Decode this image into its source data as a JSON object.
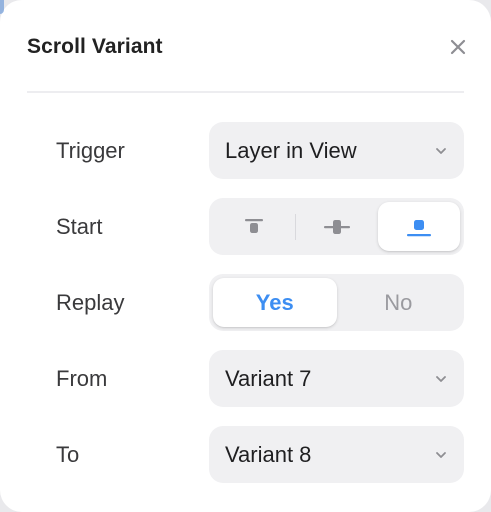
{
  "panel": {
    "title": "Scroll Variant"
  },
  "fields": {
    "trigger": {
      "label": "Trigger",
      "value": "Layer in View"
    },
    "start": {
      "label": "Start",
      "options": [
        "align-top-icon",
        "align-center-icon",
        "align-bottom-icon"
      ],
      "selected": "align-bottom-icon"
    },
    "replay": {
      "label": "Replay",
      "options": [
        "Yes",
        "No"
      ],
      "selected": "Yes"
    },
    "from": {
      "label": "From",
      "value": "Variant 7"
    },
    "to": {
      "label": "To",
      "value": "Variant 8"
    }
  },
  "colors": {
    "accent": "#3d8ef2",
    "field_bg": "#f0f0f2",
    "icon_gray": "#8e8e93"
  }
}
